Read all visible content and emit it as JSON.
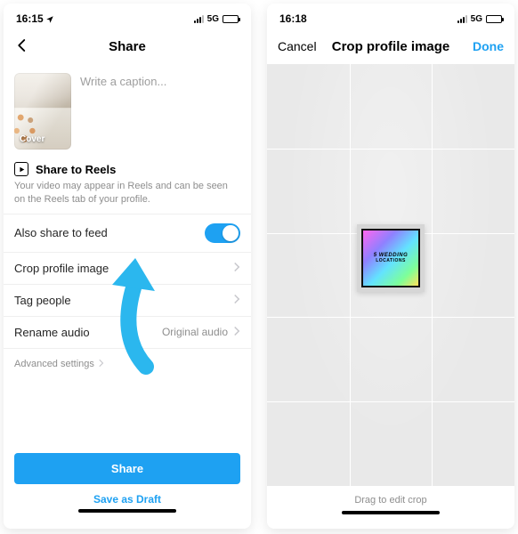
{
  "left": {
    "status": {
      "time": "16:15",
      "net": "5G"
    },
    "nav": {
      "title": "Share"
    },
    "thumb_label": "Cover",
    "caption_placeholder": "Write a caption...",
    "reels": {
      "heading": "Share to Reels",
      "desc": "Your video may appear in Reels and can be seen on the Reels tab of your profile."
    },
    "rows": {
      "also_feed": "Also share to feed",
      "crop": "Crop profile image",
      "tag": "Tag people",
      "rename": "Rename audio",
      "rename_value": "Original audio",
      "advanced": "Advanced settings"
    },
    "buttons": {
      "share": "Share",
      "draft": "Save as Draft"
    }
  },
  "right": {
    "status": {
      "time": "16:18",
      "net": "5G"
    },
    "nav": {
      "title": "Crop profile image",
      "cancel": "Cancel",
      "done": "Done"
    },
    "image_text": {
      "line1": "5 WEDDING",
      "line2": "LOCATIONS"
    },
    "hint": "Drag to edit crop"
  }
}
